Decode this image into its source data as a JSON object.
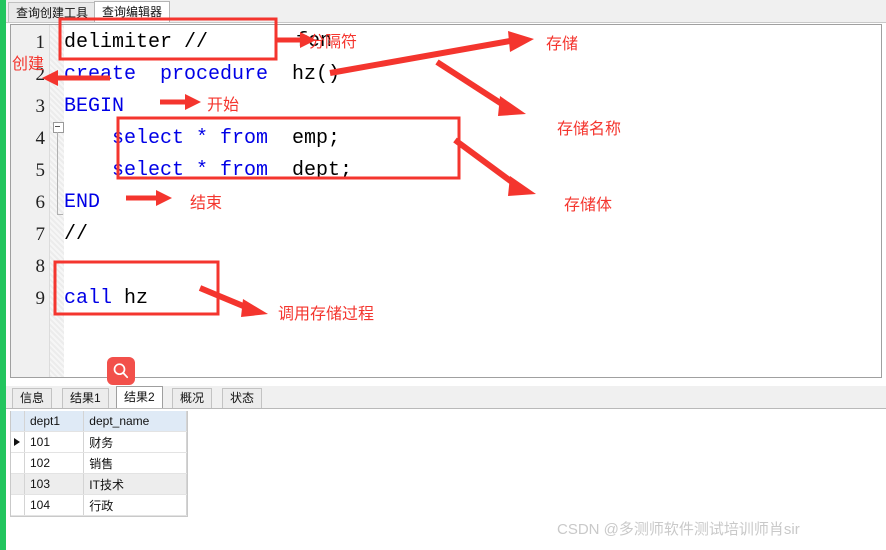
{
  "app": {
    "accent_green": "#22c55e",
    "annotation_red": "#f4352e",
    "keyword_blue": "#0000e6"
  },
  "top_tabs": [
    {
      "label": "查询创建工具",
      "active": false
    },
    {
      "label": "查询编辑器",
      "active": true
    }
  ],
  "editor": {
    "line_numbers": [
      "1",
      "2",
      "3",
      "4",
      "5",
      "6",
      "7",
      "8",
      "9"
    ],
    "lines": [
      {
        "n": "1",
        "plain_before": "delimiter //",
        "keyword": "",
        "plain_after": ""
      },
      {
        "n": "2",
        "keyword": "create  procedure",
        "plain_after": "  hz()"
      },
      {
        "n": "3",
        "keyword": "BEGIN",
        "plain_after": ""
      },
      {
        "n": "4",
        "keyword": "    select * from",
        "plain_after": "  emp;"
      },
      {
        "n": "5",
        "keyword": "    select * from",
        "plain_after": "  dept;"
      },
      {
        "n": "6",
        "keyword": "END",
        "plain_after": ""
      },
      {
        "n": "7",
        "plain_before": "//",
        "keyword": "",
        "plain_after": ""
      },
      {
        "n": "8",
        "plain_before": "",
        "keyword": "",
        "plain_after": ""
      },
      {
        "n": "9",
        "keyword": "call",
        "plain_after": " hz"
      }
    ],
    "stray_text": "fen"
  },
  "annotations": [
    {
      "id": "a-create",
      "text": "创建"
    },
    {
      "id": "a-delim",
      "text": "分隔符"
    },
    {
      "id": "a-begin",
      "text": "开始"
    },
    {
      "id": "a-end",
      "text": "结束"
    },
    {
      "id": "a-store",
      "text": "存储"
    },
    {
      "id": "a-storename",
      "text": "存储名称"
    },
    {
      "id": "a-storebody",
      "text": "存储体"
    },
    {
      "id": "a-call",
      "text": "调用存储过程"
    }
  ],
  "search_fab": {
    "icon": "search-icon"
  },
  "result_tabs": [
    {
      "label": "信息",
      "active": false
    },
    {
      "label": "结果1",
      "active": false
    },
    {
      "label": "结果2",
      "active": true
    },
    {
      "label": "概况",
      "active": false
    },
    {
      "label": "状态",
      "active": false
    }
  ],
  "result_grid": {
    "columns": [
      "dept1",
      "dept_name"
    ],
    "rows": [
      {
        "dept1": "101",
        "dept_name": "财务",
        "selected": true
      },
      {
        "dept1": "102",
        "dept_name": "销售",
        "selected": false
      },
      {
        "dept1": "103",
        "dept_name": "IT技术",
        "selected": false
      },
      {
        "dept1": "104",
        "dept_name": "行政",
        "selected": false
      }
    ]
  },
  "watermark": {
    "text": "CSDN @多测师软件测试培训师肖sir"
  }
}
